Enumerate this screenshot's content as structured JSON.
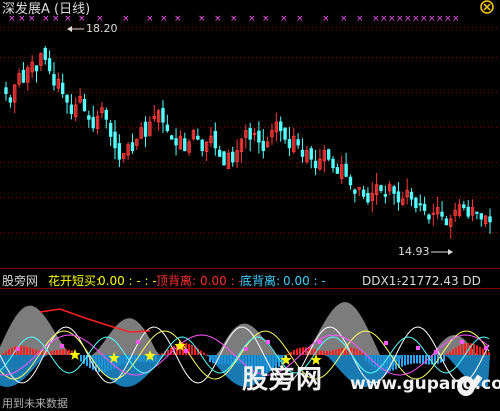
{
  "window": {
    "title": "深发展A (日线)",
    "close_icon": "close-circle-icon"
  },
  "price_panel": {
    "high_label": "18.20",
    "low_label": "14.93"
  },
  "indicator_bar": {
    "name": "股旁网",
    "huakai_label": "花开短买:",
    "huakai_value": "0.00 : - : -",
    "dingbei_label": "顶背离:",
    "dingbei_value": "0.00 : -",
    "dibei_label": "底背离:",
    "dibei_value": "0.00 : -",
    "ddx_label": "DDX1:",
    "ddx_value": "-21772.43  DD"
  },
  "footer": {
    "note": "用到未来数据"
  },
  "watermark": {
    "text": "股旁网",
    "url": "www.gupang.com",
    "icon": "key-icon"
  },
  "colors": {
    "background": "#000000",
    "up_candle": "#ff3a3a",
    "down_candle": "#54ffff",
    "grid": "#8a0000",
    "marker": "#ff55ff",
    "stars": "#ffff00",
    "histogram_positive": "#ff2020",
    "histogram_negative": "#2aa8ff"
  },
  "chart_data": {
    "type": "candlestick",
    "title": "深发展A (日线)",
    "high_label": 18.2,
    "low_label": 14.93,
    "price_range": [
      14.5,
      18.5
    ],
    "closes": [
      17.35,
      17.2,
      17.5,
      17.7,
      17.55,
      17.8,
      17.9,
      17.75,
      18.05,
      17.95,
      17.75,
      17.5,
      17.6,
      17.35,
      17.2,
      17.0,
      17.15,
      17.3,
      17.05,
      16.9,
      16.75,
      16.95,
      17.1,
      16.9,
      16.6,
      16.4,
      16.2,
      16.3,
      16.45,
      16.35,
      16.55,
      16.75,
      16.6,
      16.85,
      16.95,
      17.05,
      16.85,
      16.7,
      16.55,
      16.45,
      16.6,
      16.35,
      16.5,
      16.7,
      16.55,
      16.35,
      16.5,
      16.6,
      16.4,
      16.25,
      16.1,
      16.3,
      16.15,
      16.35,
      16.55,
      16.7,
      16.55,
      16.65,
      16.5,
      16.35,
      16.5,
      16.7,
      16.85,
      16.7,
      16.55,
      16.4,
      16.6,
      16.45,
      16.25,
      16.35,
      16.2,
      16.05,
      16.2,
      16.35,
      16.2,
      16.05,
      15.95,
      16.1,
      15.9,
      15.75,
      15.6,
      15.7,
      15.55,
      15.45,
      15.6,
      15.75,
      15.65,
      15.55,
      15.75,
      15.6,
      15.45,
      15.5,
      15.65,
      15.5,
      15.35,
      15.4,
      15.3,
      15.15,
      15.25,
      15.35,
      15.2,
      15.05,
      15.15,
      15.3,
      15.4,
      15.35,
      15.2,
      15.35,
      15.25,
      15.15,
      15.2,
      15.1
    ]
  }
}
